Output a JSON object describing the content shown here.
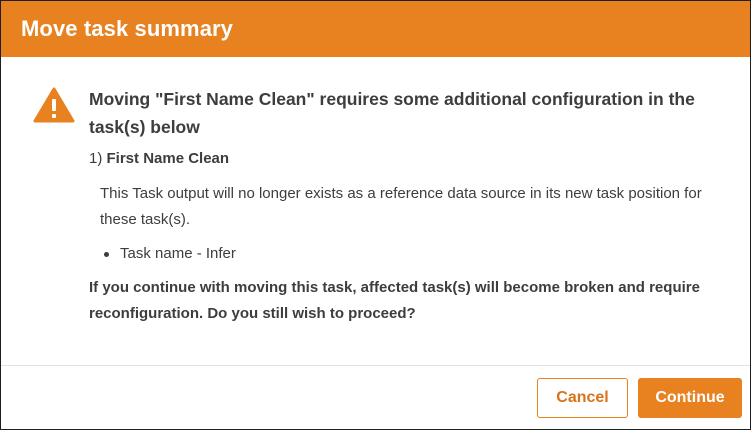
{
  "dialog": {
    "title": "Move task summary",
    "message": "Moving \"First Name Clean\" requires some additional configuration in the task(s) below",
    "task_number": "1)",
    "task_name": "First Name Clean",
    "task_description": "This Task output will no longer exists as a reference data source in its new task position for these task(s).",
    "affected_tasks": [
      "Task name - Infer"
    ],
    "question": "If you continue with moving this task, affected task(s) will become broken and require reconfiguration. Do you still wish to proceed?",
    "cancel_label": "Cancel",
    "continue_label": "Continue"
  },
  "icons": {
    "warning": "warning-triangle-icon"
  },
  "colors": {
    "accent": "#e8811f",
    "text": "#3d3d3d",
    "header_text": "#ffffff"
  }
}
